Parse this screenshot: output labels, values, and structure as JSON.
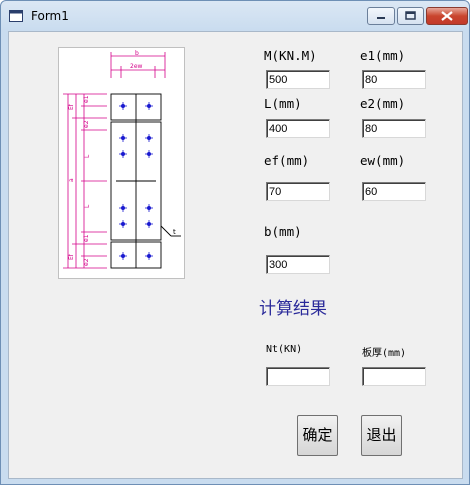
{
  "window": {
    "title": "Form1"
  },
  "inputs": {
    "M": {
      "label": "M(KN.M)",
      "value": "500"
    },
    "e1": {
      "label": "e1(mm)",
      "value": "80"
    },
    "L": {
      "label": "L(mm)",
      "value": "400"
    },
    "e2": {
      "label": "e2(mm)",
      "value": "80"
    },
    "ef": {
      "label": "ef(mm)",
      "value": "70"
    },
    "ew": {
      "label": "ew(mm)",
      "value": "60"
    },
    "b": {
      "label": "b(mm)",
      "value": "300"
    }
  },
  "results": {
    "title": "计算结果",
    "Nt": {
      "label": "Nt(KN)",
      "value": ""
    },
    "thickness": {
      "label": "板厚(mm)",
      "value": ""
    }
  },
  "buttons": {
    "ok": "确定",
    "exit": "退出"
  },
  "diagram": {
    "dim_b": "b",
    "dim_2ew": "2ew",
    "dim_a": "a",
    "dim_L1": "L",
    "dim_L2": "L",
    "dim_t": "t",
    "dims_left": [
      "Ef",
      "Ef"
    ],
    "dims_inner": [
      "e1",
      "e2",
      "e1",
      "e2"
    ],
    "colors": {
      "dimension": "#d4008a",
      "bolt": "#1a1ad0"
    }
  }
}
